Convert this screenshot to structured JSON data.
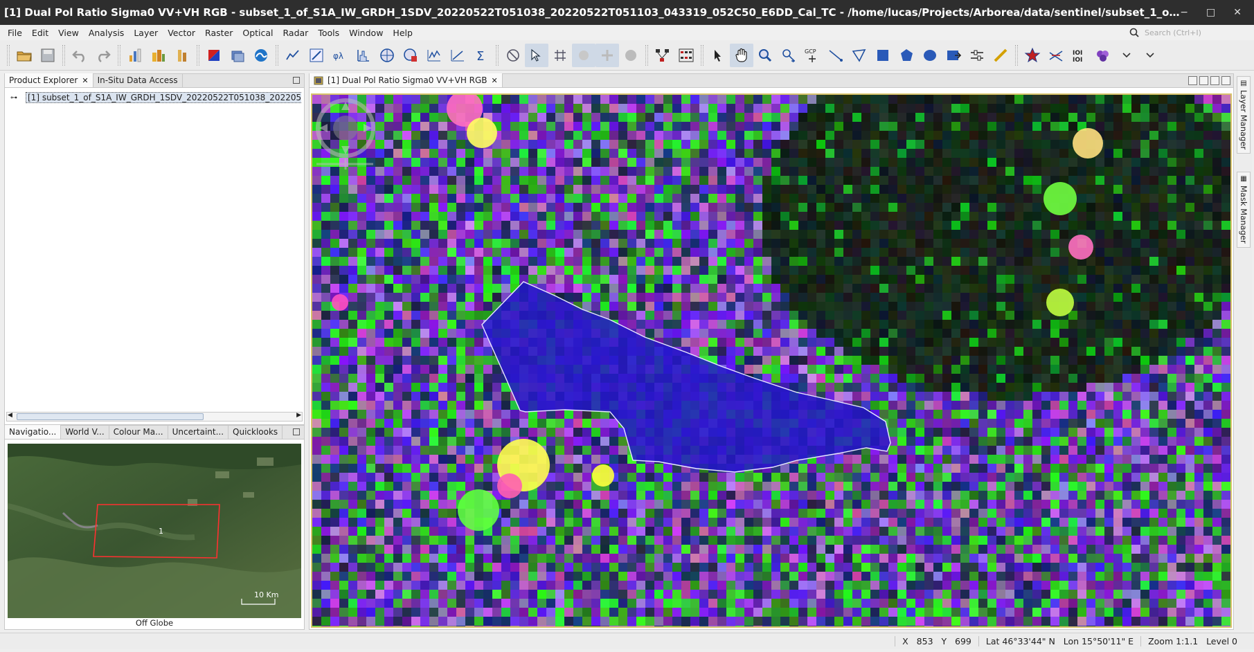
{
  "window": {
    "title": "[1] Dual Pol Ratio Sigma0 VV+VH RGB - subset_1_of_S1A_IW_GRDH_1SDV_20220522T051038_20220522T051103_043319_052C50_E6DD_Cal_TC - /home/lucas/Projects/Arborea/data/sentinel/subset_1_of_S1A_IW_GRDH_1SDV_20220522T0510...",
    "minimize": "−",
    "maximize": "□",
    "close": "✕"
  },
  "menu": [
    "File",
    "Edit",
    "View",
    "Analysis",
    "Layer",
    "Vector",
    "Raster",
    "Optical",
    "Radar",
    "Tools",
    "Window",
    "Help"
  ],
  "search": {
    "placeholder": "Search (Ctrl+I)"
  },
  "product_panel": {
    "tabs": [
      "Product Explorer",
      "In-Situ Data Access"
    ],
    "tree_item": "[1] subset_1_of_S1A_IW_GRDH_1SDV_20220522T051038_20220522T"
  },
  "nav_panel": {
    "tabs": [
      "Navigatio...",
      "World V...",
      "Colour Ma...",
      "Uncertaint...",
      "Quicklooks"
    ],
    "scale_label": "10 Km",
    "marker": "1",
    "footer": "Off Globe"
  },
  "view": {
    "tab_label": "[1] Dual Pol Ratio Sigma0 VV+VH RGB"
  },
  "right_sidebar": [
    "Layer Manager",
    "Mask Manager"
  ],
  "status": {
    "x_label": "X",
    "x_value": "853",
    "y_label": "Y",
    "y_value": "699",
    "latlon": "Lat 46°33'44\" N   Lon 15°50'11\" E",
    "zoom": "Zoom 1:1.1   Level 0"
  }
}
